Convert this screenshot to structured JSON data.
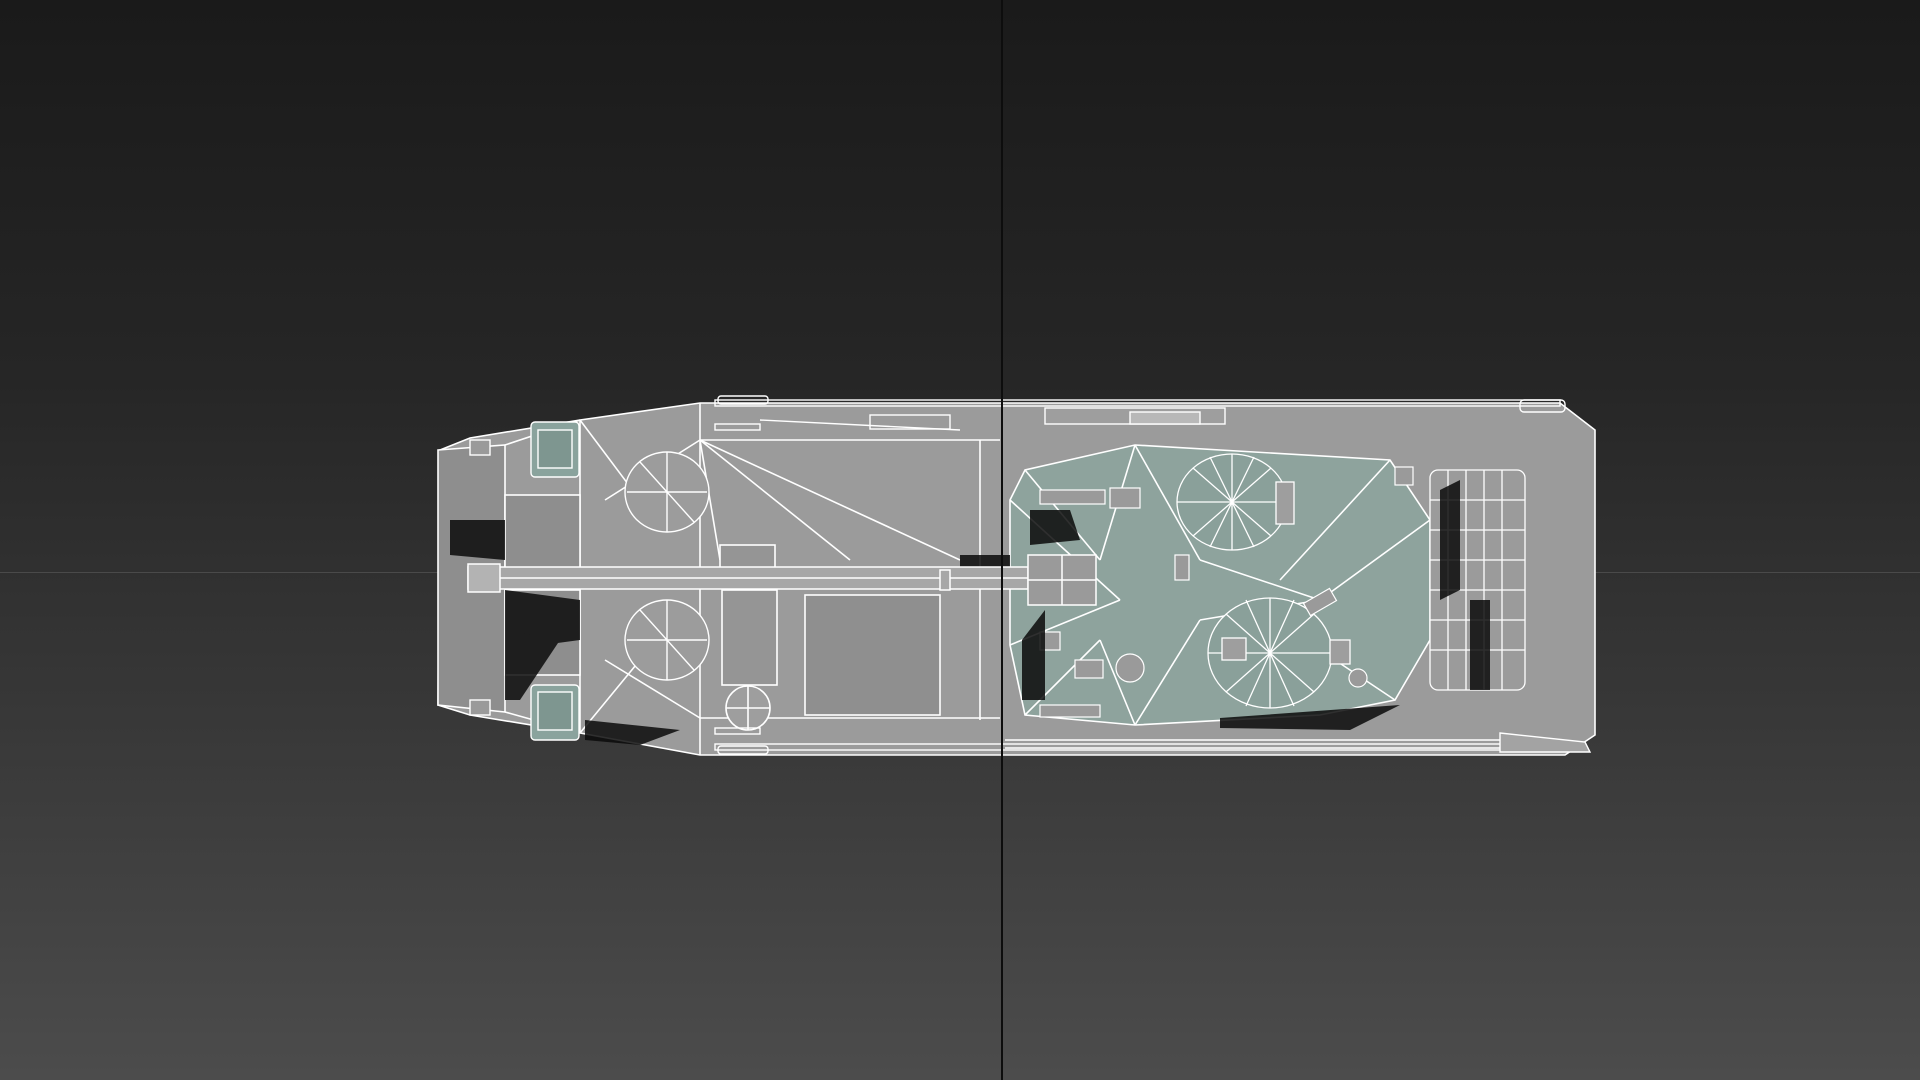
{
  "viewport": {
    "background_top": "#1a1a1a",
    "background_bottom": "#4c4c4c",
    "axis_color": "#0d0d0d"
  },
  "model": {
    "hull_color": "#9a9a9a",
    "turret_color": "#8fa49e",
    "wire_color": "#ffffff",
    "shadow_color": "#0a0a0a"
  }
}
